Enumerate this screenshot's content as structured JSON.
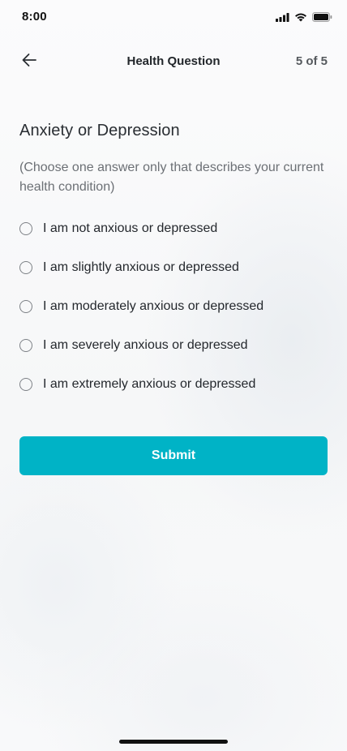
{
  "status_bar": {
    "time": "8:00",
    "icons": [
      "cellular-signal-icon",
      "wifi-icon",
      "battery-icon"
    ]
  },
  "header": {
    "back_icon": "arrow-left-icon",
    "title": "Health Question",
    "progress": "5 of 5"
  },
  "question": {
    "title": "Anxiety or Depression",
    "hint": "(Choose one answer only that describes your current health condition)",
    "options": [
      {
        "label": "I am not anxious or depressed",
        "selected": false
      },
      {
        "label": "I am slightly anxious or depressed",
        "selected": false
      },
      {
        "label": "I am moderately anxious or depressed",
        "selected": false
      },
      {
        "label": "I am severely anxious or depressed",
        "selected": false
      },
      {
        "label": "I am extremely anxious or depressed",
        "selected": false
      }
    ]
  },
  "submit": {
    "label": "Submit"
  },
  "colors": {
    "accent": "#00b3c6",
    "text_primary": "#24282d",
    "text_secondary": "#6c7075"
  }
}
